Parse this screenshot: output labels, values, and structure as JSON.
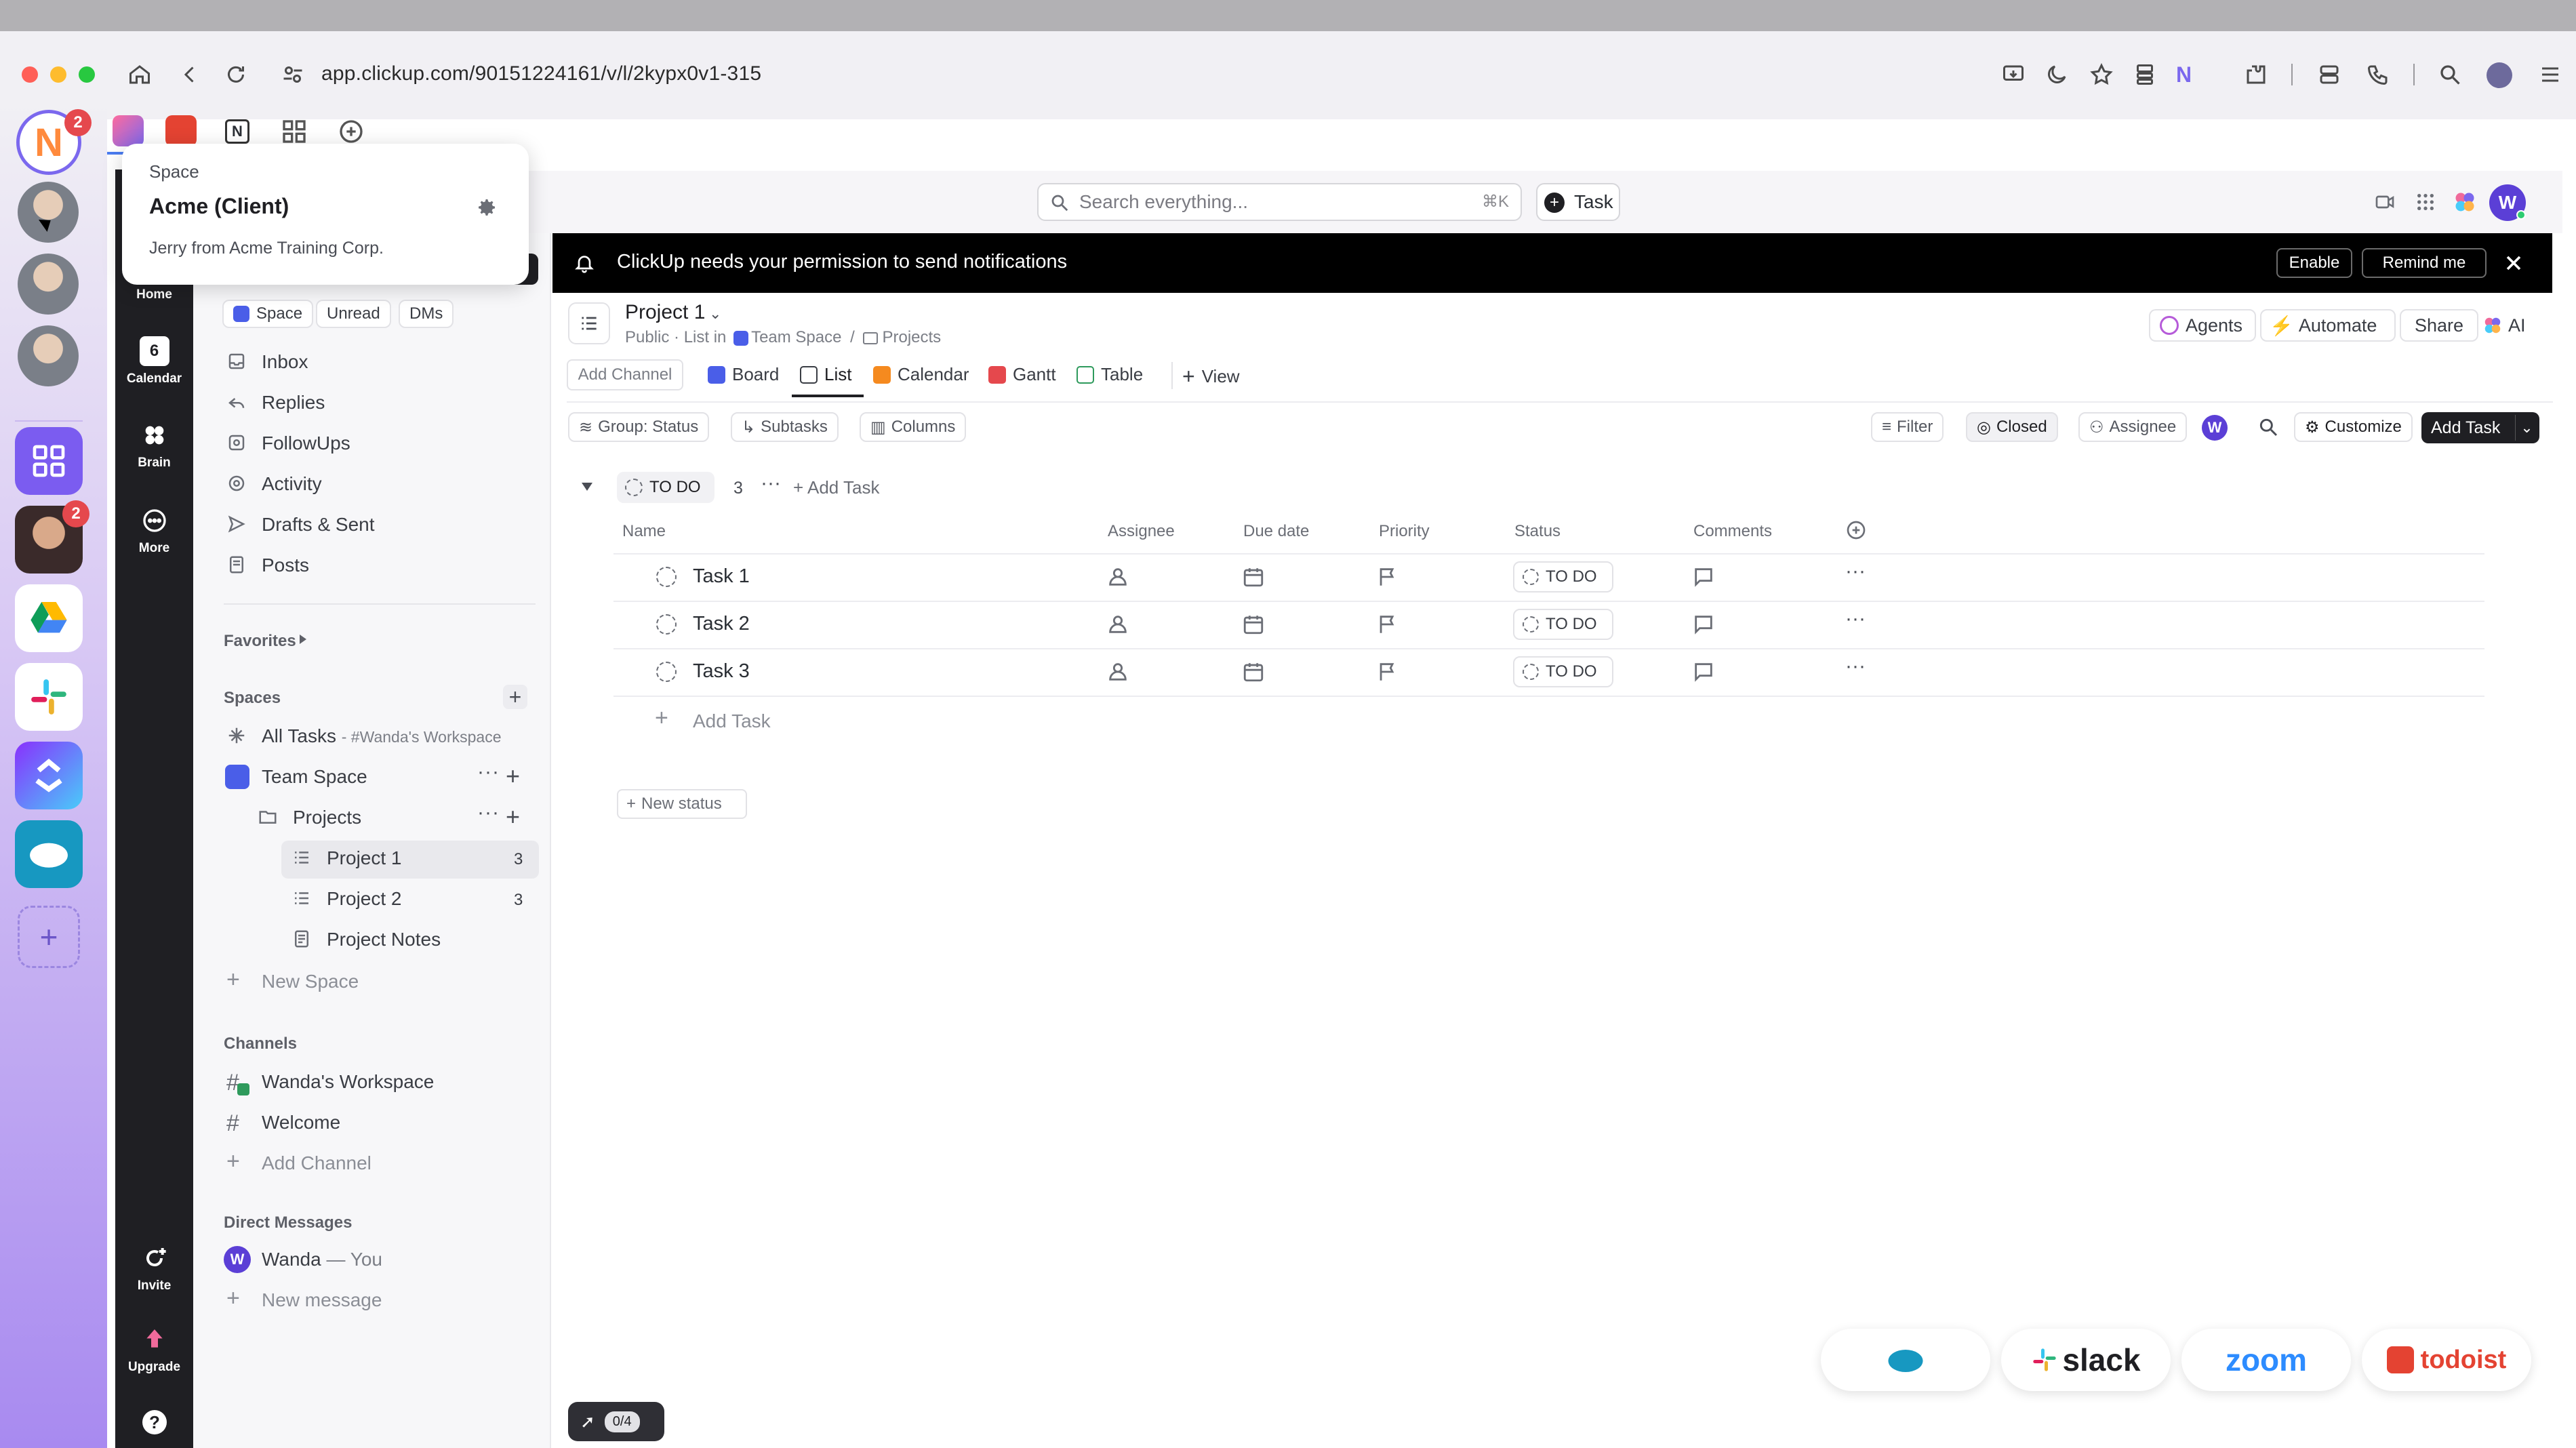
{
  "browser": {
    "url": "app.clickup.com/90151224161/v/l/2kypx0v1-315",
    "dock_badges": {
      "top_app": "2",
      "avatar_app": "2"
    }
  },
  "popover": {
    "label": "Space",
    "title": "Acme (Client)",
    "description": "Jerry from Acme Training Corp."
  },
  "header": {
    "search_placeholder": "Search everything...",
    "search_shortcut": "⌘K",
    "task_button": "Task",
    "user_initial": "W"
  },
  "rail": {
    "items": [
      {
        "label": "Home"
      },
      {
        "label": "Calendar",
        "badge": "6"
      },
      {
        "label": "Brain"
      },
      {
        "label": "More"
      },
      {
        "label": "Invite"
      },
      {
        "label": "Upgrade"
      }
    ],
    "help": "?"
  },
  "sidebar": {
    "filter_chips": [
      "Space",
      "Unread",
      "DMs"
    ],
    "inbox_items": [
      "Inbox",
      "Replies",
      "FollowUps",
      "Activity",
      "Drafts & Sent",
      "Posts"
    ],
    "favorites": "Favorites",
    "spaces_heading": "Spaces",
    "all_tasks": "All Tasks",
    "all_tasks_suffix": "- #Wanda's Workspace",
    "team_space": "Team Space",
    "folder": "Projects",
    "lists": [
      {
        "name": "Project 1",
        "count": "3"
      },
      {
        "name": "Project 2",
        "count": "3"
      },
      {
        "name": "Project Notes",
        "count": ""
      }
    ],
    "new_space": "New Space",
    "channels_heading": "Channels",
    "channels": [
      "Wanda's Workspace",
      "Welcome"
    ],
    "add_channel": "Add Channel",
    "dm_heading": "Direct Messages",
    "dm_user": "Wanda",
    "dm_you": "— You",
    "dm_initial": "W",
    "new_message": "New message"
  },
  "notification": {
    "text": "ClickUp needs your permission to send notifications",
    "enable": "Enable",
    "remind": "Remind me"
  },
  "list": {
    "title": "Project 1",
    "breadcrumb_prefix": "Public · List in",
    "breadcrumb_space": "Team Space",
    "breadcrumb_sep": "/",
    "breadcrumb_folder": "Projects",
    "actions": [
      "Agents",
      "Automate",
      "Share",
      "AI"
    ],
    "add_channel": "Add Channel",
    "views": [
      "Board",
      "List",
      "Calendar",
      "Gantt",
      "Table"
    ],
    "add_view": "View",
    "toolbar": {
      "group": "Group: Status",
      "subtasks": "Subtasks",
      "columns": "Columns",
      "filter": "Filter",
      "closed": "Closed",
      "assignee": "Assignee",
      "assignee_initial": "W",
      "customize": "Customize",
      "add_task": "Add Task"
    },
    "group": {
      "status": "TO DO",
      "count": "3",
      "add_task": "Add Task"
    },
    "columns": [
      "Name",
      "Assignee",
      "Due date",
      "Priority",
      "Status",
      "Comments"
    ],
    "tasks": [
      {
        "name": "Task 1",
        "status": "TO DO"
      },
      {
        "name": "Task 2",
        "status": "TO DO"
      },
      {
        "name": "Task 3",
        "status": "TO DO"
      }
    ],
    "add_task_row": "Add Task",
    "new_status": "New status"
  },
  "integrations": [
    "salesforce",
    "slack",
    "zoom",
    "todoist"
  ],
  "onboarding": "0/4",
  "colors": {
    "accent": "#7b68ee",
    "dark": "#1f1f23",
    "banner": "#000000"
  }
}
